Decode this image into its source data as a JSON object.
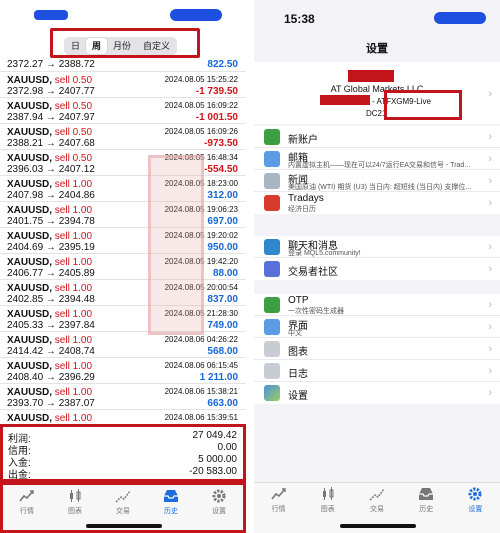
{
  "left": {
    "status_time": "15:38",
    "segments": [
      {
        "label": "日",
        "active": false
      },
      {
        "label": "周",
        "active": true
      },
      {
        "label": "月份",
        "active": false
      },
      {
        "label": "自定义",
        "active": false
      }
    ],
    "first_row": {
      "prices": "2372.27 → 2388.72",
      "profit": "822.50",
      "sign": "pos"
    },
    "trades": [
      {
        "symbol": "XAUUSD,",
        "side": "sell 0.50",
        "time": "2024.08.05 15:25:22",
        "prices": "2372.98 → 2407.77",
        "profit": "-1 739.50",
        "sign": "neg"
      },
      {
        "symbol": "XAUUSD,",
        "side": "sell 0.50",
        "time": "2024.08.05 16:09:22",
        "prices": "2387.94 → 2407.97",
        "profit": "-1 001.50",
        "sign": "neg"
      },
      {
        "symbol": "XAUUSD,",
        "side": "sell 0.50",
        "time": "2024.08.05 16:09:26",
        "prices": "2388.21 → 2407.68",
        "profit": "-973.50",
        "sign": "neg"
      },
      {
        "symbol": "XAUUSD,",
        "side": "sell 0.50",
        "time": "2024.08.05 16:48:34",
        "prices": "2396.03 → 2407.12",
        "profit": "-554.50",
        "sign": "neg"
      },
      {
        "symbol": "XAUUSD,",
        "side": "sell 1.00",
        "time": "2024.08.05 18:23:00",
        "prices": "2407.98 → 2404.86",
        "profit": "312.00",
        "sign": "pos"
      },
      {
        "symbol": "XAUUSD,",
        "side": "sell 1.00",
        "time": "2024.08.05 19:06:23",
        "prices": "2401.75 → 2394.78",
        "profit": "697.00",
        "sign": "pos"
      },
      {
        "symbol": "XAUUSD,",
        "side": "sell 1.00",
        "time": "2024.08.05 19:20:02",
        "prices": "2404.69 → 2395.19",
        "profit": "950.00",
        "sign": "pos"
      },
      {
        "symbol": "XAUUSD,",
        "side": "sell 1.00",
        "time": "2024.08.05 19:42:20",
        "prices": "2406.77 → 2405.89",
        "profit": "88.00",
        "sign": "pos"
      },
      {
        "symbol": "XAUUSD,",
        "side": "sell 1.00",
        "time": "2024.08.05 20:00:54",
        "prices": "2402.85 → 2394.48",
        "profit": "837.00",
        "sign": "pos"
      },
      {
        "symbol": "XAUUSD,",
        "side": "sell 1.00",
        "time": "2024.08.05 21:28:30",
        "prices": "2405.33 → 2397.84",
        "profit": "749.00",
        "sign": "pos"
      },
      {
        "symbol": "XAUUSD,",
        "side": "sell 1.00",
        "time": "2024.08.06 04:26:22",
        "prices": "2414.42 → 2408.74",
        "profit": "568.00",
        "sign": "pos"
      },
      {
        "symbol": "XAUUSD,",
        "side": "sell 1.00",
        "time": "2024.08.06 06:15:45",
        "prices": "2408.40 → 2396.29",
        "profit": "1 211.00",
        "sign": "pos"
      },
      {
        "symbol": "XAUUSD,",
        "side": "sell 1.00",
        "time": "2024.08.06 15:38:21",
        "prices": "2393.70 → 2387.07",
        "profit": "663.00",
        "sign": "pos"
      },
      {
        "symbol": "XAUUSD,",
        "side": "sell 1.00",
        "time": "2024.08.06 15:39:51",
        "prices": "2395.27 → 2387.09",
        "profit": "409.00",
        "sign": "pos"
      }
    ],
    "summary": [
      {
        "key": "利润:",
        "value": "27 049.42"
      },
      {
        "key": "信用:",
        "value": "0.00"
      },
      {
        "key": "入金:",
        "value": "5 000.00"
      },
      {
        "key": "出金:",
        "value": "-20 583.00"
      }
    ],
    "tabs": [
      {
        "label": "行情",
        "icon": "chart-icon",
        "active": false
      },
      {
        "label": "图表",
        "icon": "candles-icon",
        "active": false
      },
      {
        "label": "交易",
        "icon": "trade-icon",
        "active": false
      },
      {
        "label": "历史",
        "icon": "history-icon",
        "active": true
      },
      {
        "label": "设置",
        "icon": "gear-icon",
        "active": false
      }
    ]
  },
  "right": {
    "status_time": "15:38",
    "title": "设置",
    "account": {
      "company": "AT Global Markets LLC",
      "server": "- ATFXGM9-Live",
      "server_prefix": "DC21"
    },
    "group1": [
      {
        "label": "新账户",
        "sub": "",
        "icon": "person-add-icon",
        "color": "green"
      },
      {
        "label": "邮箱",
        "sub": "内置虚拟主机——现在可以24/7运行EA交易和信号 - Trad...",
        "icon": "mail-icon",
        "color": "lblue"
      },
      {
        "label": "新闻",
        "sub": "美国原油 (WTI) 期货 (U3) 当日内: 超短线 (当日内) 支撑位...",
        "icon": "news-icon",
        "color": "lightg"
      },
      {
        "label": "Tradays",
        "sub": "经济日历",
        "icon": "calendar-icon",
        "color": "red"
      }
    ],
    "group2": [
      {
        "label": "聊天和消息",
        "sub": "登录 MQL5.community!",
        "icon": "chat-icon",
        "color": "teal"
      },
      {
        "label": "交易者社区",
        "sub": "",
        "icon": "community-icon",
        "color": "purple"
      }
    ],
    "group3": [
      {
        "label": "OTP",
        "sub": "一次性密码生成器",
        "icon": "otp-icon",
        "color": "green"
      },
      {
        "label": "界面",
        "sub": "中文",
        "icon": "language-icon",
        "color": "lblue"
      },
      {
        "label": "图表",
        "sub": "",
        "icon": "chart-settings-icon",
        "color": "gray"
      },
      {
        "label": "日志",
        "sub": "",
        "icon": "journal-icon",
        "color": "gray"
      },
      {
        "label": "设置",
        "sub": "",
        "icon": "settings-icon",
        "color": "gradient"
      }
    ],
    "tabs": [
      {
        "label": "行情",
        "icon": "chart-icon",
        "active": false
      },
      {
        "label": "图表",
        "icon": "candles-icon",
        "active": false
      },
      {
        "label": "交易",
        "icon": "trade-icon",
        "active": false
      },
      {
        "label": "历史",
        "icon": "history-icon",
        "active": false
      },
      {
        "label": "设置",
        "icon": "gear-icon",
        "active": true
      }
    ]
  },
  "colors": {
    "accent": "#1b6de0",
    "loss": "#d0141b",
    "profit": "#1867d8",
    "highlight_box": "#c4141b"
  }
}
